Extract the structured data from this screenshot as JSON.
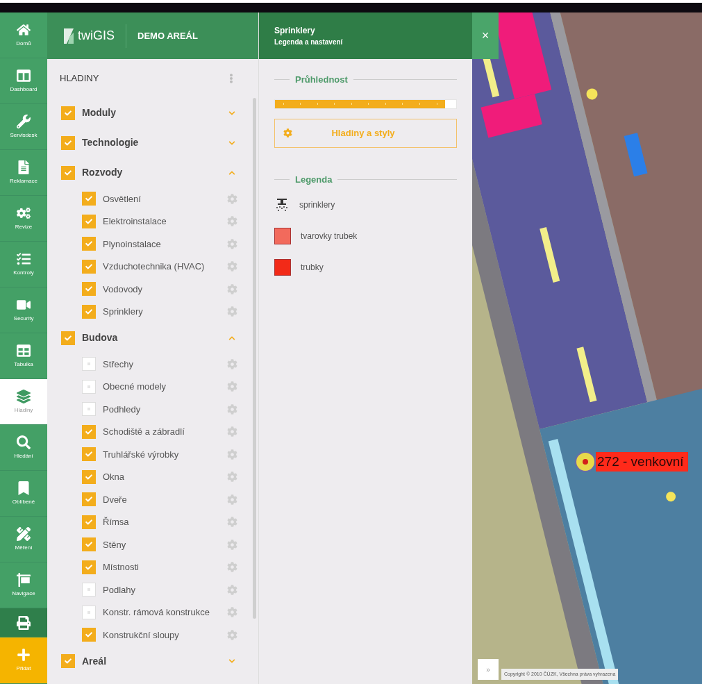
{
  "nav": [
    {
      "label": "Domů",
      "kind": "item",
      "selected": false
    },
    {
      "label": "Dashboard",
      "kind": "item",
      "selected": false
    },
    {
      "label": "Servisdesk",
      "kind": "item",
      "selected": false
    },
    {
      "label": "Reklamace",
      "kind": "item",
      "selected": false
    },
    {
      "label": "Revize",
      "kind": "item",
      "selected": false
    },
    {
      "label": "Kontroly",
      "kind": "item",
      "selected": false
    },
    {
      "label": "Security",
      "kind": "item",
      "selected": false
    },
    {
      "label": "Tabulka",
      "kind": "item",
      "selected": false
    },
    {
      "label": "Hladiny",
      "kind": "item",
      "selected": true
    },
    {
      "label": "Hledání",
      "kind": "item",
      "selected": false
    },
    {
      "label": "Oblíbené",
      "kind": "item",
      "selected": false
    },
    {
      "label": "Měření",
      "kind": "item",
      "selected": false
    },
    {
      "label": "Navigace",
      "kind": "item",
      "selected": false
    },
    {
      "kind": "print"
    },
    {
      "label": "Přidat",
      "kind": "add"
    }
  ],
  "header": {
    "app_name": "twiGIS",
    "project": "DEMO AREÁL"
  },
  "layers": {
    "title": "HLADINY",
    "groups": [
      {
        "label": "Moduly",
        "checked": true,
        "expanded": false
      },
      {
        "label": "Technologie",
        "checked": true,
        "expanded": false
      },
      {
        "label": "Rozvody",
        "checked": true,
        "expanded": true,
        "children": [
          {
            "label": "Osvětlení",
            "checked": true
          },
          {
            "label": "Elektroinstalace",
            "checked": true
          },
          {
            "label": "Plynoinstalace",
            "checked": true
          },
          {
            "label": "Vzduchotechnika (HVAC)",
            "checked": true
          },
          {
            "label": "Vodovody",
            "checked": true
          },
          {
            "label": "Sprinklery",
            "checked": true
          }
        ]
      },
      {
        "label": "Budova",
        "checked": true,
        "expanded": true,
        "children": [
          {
            "label": "Střechy",
            "checked": false
          },
          {
            "label": "Obecné modely",
            "checked": false
          },
          {
            "label": "Podhledy",
            "checked": false
          },
          {
            "label": "Schodiště a zábradlí",
            "checked": true
          },
          {
            "label": "Truhlářské výrobky",
            "checked": true
          },
          {
            "label": "Okna",
            "checked": true
          },
          {
            "label": "Dveře",
            "checked": true
          },
          {
            "label": "Římsa",
            "checked": true
          },
          {
            "label": "Stěny",
            "checked": true
          },
          {
            "label": "Místnosti",
            "checked": true
          },
          {
            "label": "Podlahy",
            "checked": false
          },
          {
            "label": "Konstr. rámová konstrukce",
            "checked": false
          },
          {
            "label": "Konstrukční sloupy",
            "checked": true
          }
        ]
      },
      {
        "label": "Areál",
        "checked": true,
        "expanded": false
      }
    ]
  },
  "detail": {
    "title": "Sprinklery",
    "subtitle": "Legenda a nastavení",
    "close": "×",
    "opacity": {
      "title": "Průhlednost",
      "level": 0.94
    },
    "styles_button": "Hladiny a styly",
    "legend": {
      "title": "Legenda",
      "items": [
        {
          "label": "sprinklery",
          "kind": "symbol"
        },
        {
          "label": "tvarovky trubek",
          "kind": "swatch",
          "color": "#f26a5c"
        },
        {
          "label": "trubky",
          "kind": "swatch",
          "color": "#f22a18"
        }
      ]
    }
  },
  "map": {
    "kind": "picture",
    "marker_label": "272 - venkovní",
    "expand_button": "»",
    "copyright": "Copyright © 2010 ČÚZK, Všechna práva vyhrazena"
  }
}
